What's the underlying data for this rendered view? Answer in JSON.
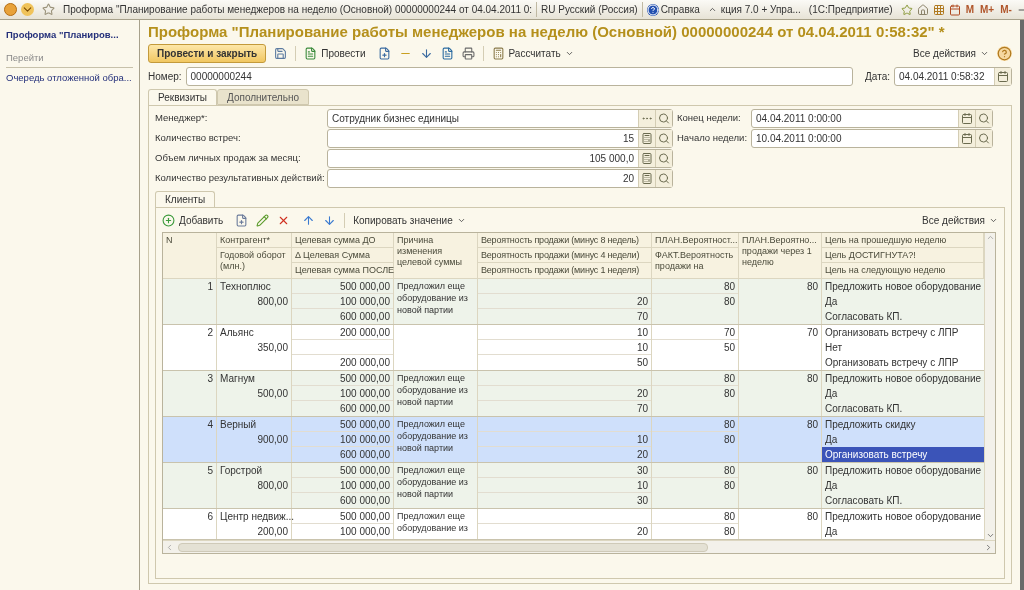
{
  "topbar": {
    "title": "Проформа \"Планирование работы менеджеров на неделю (Основной)  00000000244 от 04.04.2011 0:",
    "language": "RU Русский (Россия)",
    "help": "Справка",
    "app": "кция 7.0 + Упра...",
    "platform": "(1С:Предприятие)",
    "memory": [
      "M",
      "M+",
      "M-"
    ]
  },
  "sidebar": {
    "title": "Проформа \"Планиров...",
    "section": "Перейти",
    "items": [
      "Очередь отложенной обра..."
    ]
  },
  "form": {
    "title": "Проформа \"Планирование работы менеджеров на неделю (Основной)  00000000244 от 04.04.2011 0:58:32\" *",
    "toolbar": {
      "post_close": "Провести и закрыть",
      "post": "Провести",
      "calculate": "Рассчитать",
      "all_actions": "Все действия"
    },
    "number_label": "Номер:",
    "number": "00000000244",
    "date_label": "Дата:",
    "date": "04.04.2011  0:58:32",
    "tabs": [
      {
        "label": "Реквизиты",
        "selected": true
      },
      {
        "label": "Дополнительно",
        "selected": false
      }
    ],
    "fields": [
      {
        "label": "Менеджер*:",
        "value": "Сотрудник бизнес единицы",
        "kind": "ref"
      },
      {
        "label": "Количество встреч:",
        "value": "15",
        "kind": "number"
      },
      {
        "label": "Объем личных продаж за месяц:",
        "value": "105 000,0",
        "kind": "number"
      },
      {
        "label": "Количество результативных действий:",
        "value": "20",
        "kind": "number"
      }
    ],
    "week_fields": [
      {
        "label": "Конец недели:",
        "value": "04.04.2011  0:00:00"
      },
      {
        "label": "Начало недели:",
        "value": "10.04.2011  0:00:00"
      }
    ],
    "inner_tabs": [
      {
        "label": "Клиенты",
        "selected": true
      }
    ],
    "table_toolbar": {
      "add": "Добавить",
      "copy_value": "Копировать значение",
      "all_actions": "Все действия"
    },
    "table": {
      "headers": {
        "n": "N",
        "name": "Контрагент*",
        "turnover": "Годовой оборот (млн.)",
        "target_before": "Целевая сумма ДО",
        "target_delta": "Δ Целевая Сумма",
        "target_after": "Целевая сумма ПОСЛЕ",
        "reason": "Причина изменения целевой суммы",
        "prob_8w": "Вероятность продажи (минус 8 недель)",
        "prob_4w": "Вероятность продажи (минус 4 недели)",
        "prob_1w": "Вероятность продажи (минус 1 неделя)",
        "plan_prob": "ПЛАН.Вероятност...",
        "fact_prob": "ФАКТ.Вероятность продажи на",
        "plan_next": "ПЛАН.Вероятно... продажи через 1 неделю",
        "goal_prev": "Цель на прошедшую неделю",
        "goal_reached": "Цель ДОСТИГНУТА?!",
        "goal_next": "Цель на следующую неделю"
      },
      "rows": [
        {
          "n": "1",
          "name": "Техноплюс",
          "turnover": "800,00",
          "target_before": "500 000,00",
          "target_delta": "100 000,00",
          "target_after": "600 000,00",
          "reason": "Предложил еще оборудование из новой партии",
          "prob_4w": "20",
          "prob_1w": "70",
          "plan_prob": "80",
          "fact_prob": "80",
          "plan_next": "80",
          "goal_prev": "Предложить новое оборудование",
          "goal_reached": "Да",
          "goal_next": "Согласовать КП.",
          "selected": false
        },
        {
          "n": "2",
          "name": "Альянс",
          "turnover": "350,00",
          "target_before": "200 000,00",
          "target_after": "200 000,00",
          "prob_8w": "10",
          "prob_4w": "10",
          "prob_1w": "50",
          "plan_prob": "70",
          "fact_prob": "50",
          "plan_next": "70",
          "goal_prev": "Организовать встречу с ЛПР",
          "goal_reached": "Нет",
          "goal_next": "Организовать встречу с ЛПР",
          "selected": false
        },
        {
          "n": "3",
          "name": "Магнум",
          "turnover": "500,00",
          "target_before": "500 000,00",
          "target_delta": "100 000,00",
          "target_after": "600 000,00",
          "reason": "Предложил еще оборудование из новой партии",
          "prob_4w": "20",
          "prob_1w": "70",
          "plan_prob": "80",
          "fact_prob": "80",
          "plan_next": "80",
          "goal_prev": "Предложить новое оборудование",
          "goal_reached": "Да",
          "goal_next": "Согласовать КП.",
          "selected": false
        },
        {
          "n": "4",
          "name": "Верный",
          "turnover": "900,00",
          "target_before": "500 000,00",
          "target_delta": "100 000,00",
          "target_after": "600 000,00",
          "reason": "Предложил еще оборудование из новой партии",
          "prob_4w": "10",
          "prob_1w": "20",
          "plan_prob": "80",
          "fact_prob": "80",
          "plan_next": "80",
          "goal_prev": "Предложить скидку",
          "goal_reached": "Да",
          "goal_next": "Организовать встречу",
          "selected": true
        },
        {
          "n": "5",
          "name": "Горстрой",
          "turnover": "800,00",
          "target_before": "500 000,00",
          "target_delta": "100 000,00",
          "target_after": "600 000,00",
          "reason": "Предложил еще оборудование из новой партии",
          "prob_8w": "30",
          "prob_4w": "10",
          "prob_1w": "30",
          "plan_prob": "80",
          "fact_prob": "80",
          "plan_next": "80",
          "goal_prev": "Предложить новое оборудование",
          "goal_reached": "Да",
          "goal_next": "Согласовать КП.",
          "selected": false
        },
        {
          "n": "6",
          "name": "Центр недвиж...",
          "turnover": "200,00",
          "target_before": "500 000,00",
          "target_delta": "100 000,00",
          "reason": "Предложил еще оборудование из",
          "prob_4w": "20",
          "plan_prob": "80",
          "fact_prob": "80",
          "plan_next": "80",
          "goal_prev": "Предложить новое оборудование",
          "goal_reached": "Да",
          "selected": false
        }
      ]
    }
  }
}
